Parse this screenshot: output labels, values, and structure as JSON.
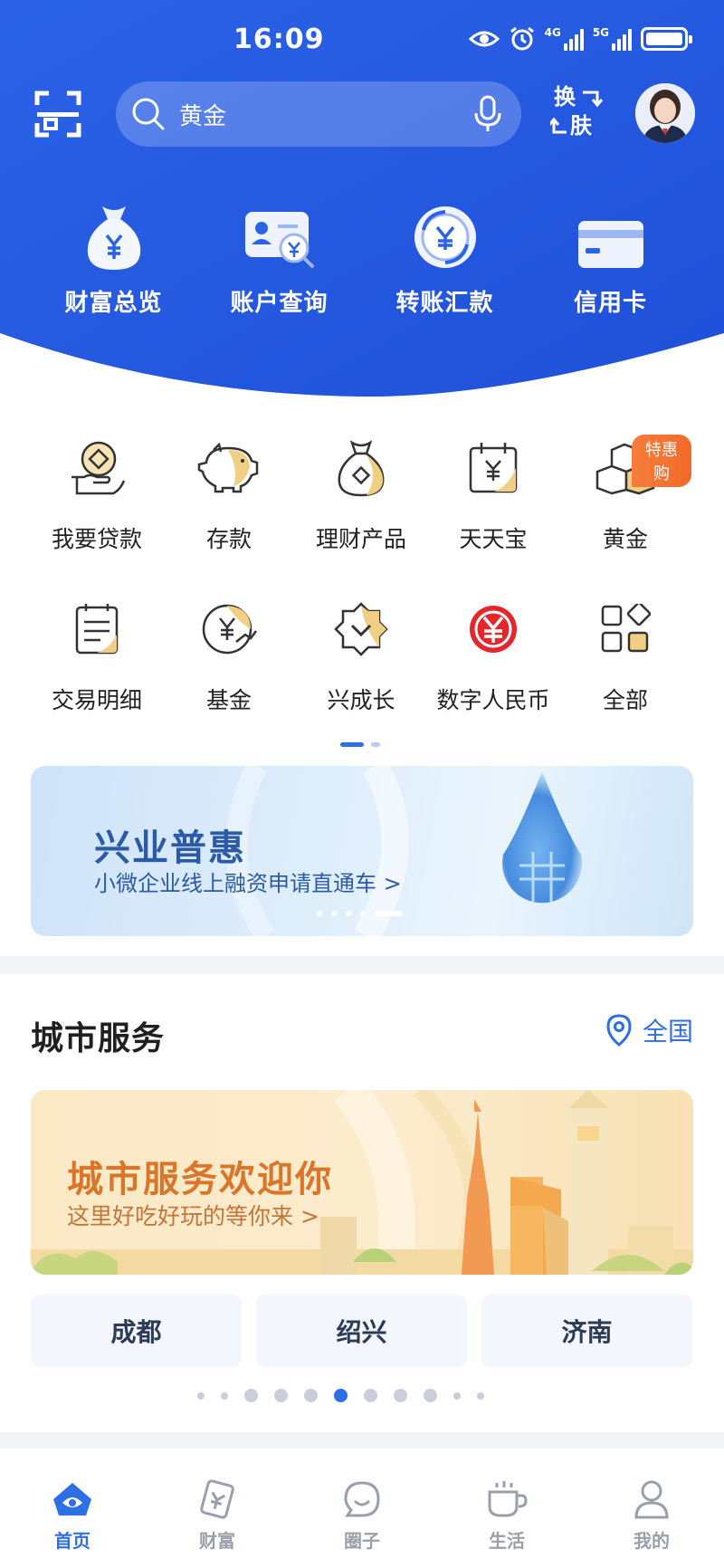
{
  "status_bar": {
    "time": "16:09",
    "net1": "4G",
    "net2": "5G"
  },
  "header": {
    "search_text": "黄金",
    "skin_line1": "换",
    "skin_line2": "肤"
  },
  "quick_actions": [
    {
      "label": "财富总览",
      "icon": "money-bag-icon"
    },
    {
      "label": "账户查询",
      "icon": "account-card-icon"
    },
    {
      "label": "转账汇款",
      "icon": "transfer-icon"
    },
    {
      "label": "信用卡",
      "icon": "credit-card-icon"
    }
  ],
  "services": [
    {
      "label": "我要贷款",
      "icon": "loan-icon"
    },
    {
      "label": "存款",
      "icon": "piggy-bank-icon"
    },
    {
      "label": "理财产品",
      "icon": "wealth-bag-icon"
    },
    {
      "label": "天天宝",
      "icon": "calendar-yuan-icon"
    },
    {
      "label": "黄金",
      "icon": "gold-bars-icon",
      "badge": "特惠购"
    },
    {
      "label": "交易明细",
      "icon": "ledger-icon"
    },
    {
      "label": "基金",
      "icon": "fund-icon"
    },
    {
      "label": "兴成长",
      "icon": "growth-icon"
    },
    {
      "label": "数字人民币",
      "icon": "digital-rmb-icon"
    },
    {
      "label": "全部",
      "icon": "all-apps-icon"
    }
  ],
  "banner": {
    "title": "兴业普惠",
    "subtitle": "小微企业线上融资申请直通车 >"
  },
  "city": {
    "title": "城市服务",
    "location": "全国",
    "banner_title": "城市服务欢迎你",
    "banner_subtitle": "这里好吃好玩的等你来 >",
    "cities": [
      "成都",
      "绍兴",
      "济南"
    ]
  },
  "tabs": [
    {
      "label": "首页",
      "icon": "home-icon",
      "active": true
    },
    {
      "label": "财富",
      "icon": "wealth-icon"
    },
    {
      "label": "圈子",
      "icon": "circle-icon"
    },
    {
      "label": "生活",
      "icon": "coffee-icon"
    },
    {
      "label": "我的",
      "icon": "profile-icon"
    }
  ],
  "colors": {
    "brand_blue": "#2f6fe6",
    "header_blue": "#2459e0",
    "accent_orange": "#f26a2a",
    "gold": "#e6b55c"
  }
}
